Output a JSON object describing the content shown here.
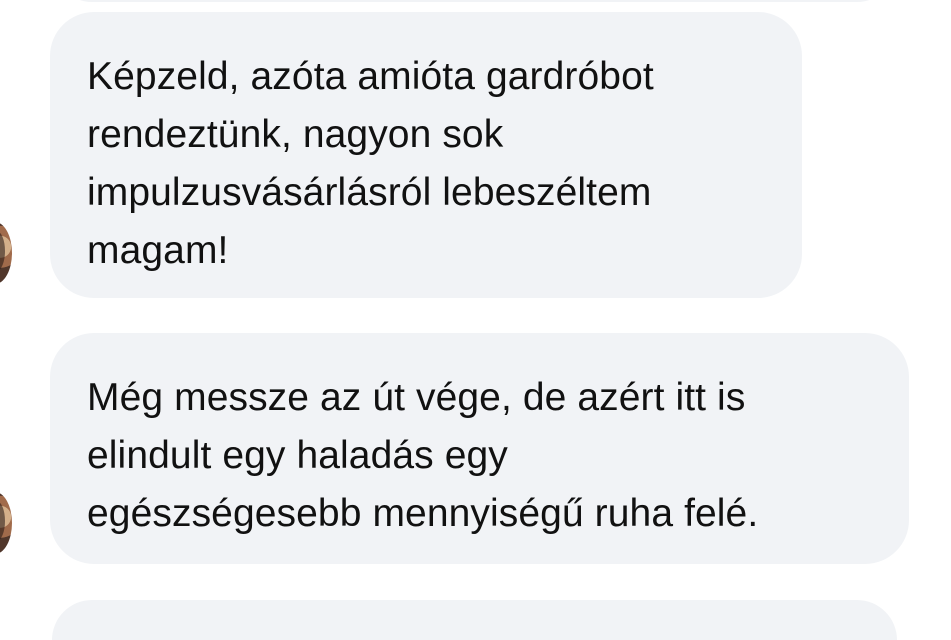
{
  "messages": [
    {
      "lines": [
        "Képzeld, azóta amióta gardróbot",
        "rendeztünk, nagyon sok",
        "impulzusvásárlásról lebeszéltem",
        "magam!"
      ]
    },
    {
      "lines": [
        "Még messze az út vége, de azért itt is",
        "elindult egy haladás egy",
        "egészségesebb mennyiségű ruha felé."
      ]
    }
  ],
  "colors": {
    "bubble_background": "#f1f3f6",
    "text": "#111111",
    "page_background": "#ffffff"
  },
  "icons": {
    "sender_avatar": "avatar"
  }
}
